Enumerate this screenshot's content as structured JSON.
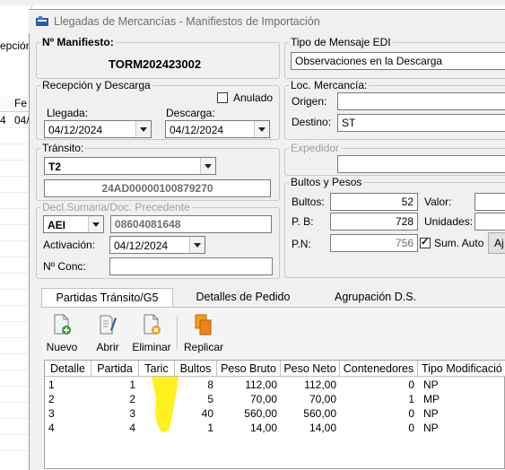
{
  "window": {
    "title": "Llegadas de Mercancías - Manifiestos de Importación"
  },
  "manifiesto": {
    "legend": "Nº Manifiesto:",
    "value": "TORM202423002"
  },
  "recepcion": {
    "legend": "Recepción y Descarga",
    "anulado_label": "Anulado",
    "anulado_checked": false,
    "llegada_label": "Llegada:",
    "llegada_value": "04/12/2024",
    "descarga_label": "Descarga:",
    "descarga_value": "04/12/2024"
  },
  "transito": {
    "legend": "Tránsito:",
    "tipo_value": "T2",
    "doc_value": "24AD00000100879270"
  },
  "declaracion": {
    "legend": "Decl.Sumaria/Doc. Precedente",
    "tipo_value": "AEI",
    "numero_value": "08604081648",
    "activacion_label": "Activación:",
    "activacion_value": "04/12/2024",
    "conc_label": "Nº Conc:",
    "conc_value": ""
  },
  "tipo_mensaje": {
    "legend": "Tipo de Mensaje EDI",
    "value": "Observaciones en la Descarga"
  },
  "loc_mercancia": {
    "legend": "Loc. Mercancía:",
    "origen_label": "Origen:",
    "origen_value": "",
    "destino_label": "Destino:",
    "destino_value": "ST"
  },
  "expedidor": {
    "legend": "Expedidor",
    "value": ""
  },
  "bultos_pesos": {
    "legend": "Bultos y Pesos",
    "bultos_label": "Bultos:",
    "bultos_value": "52",
    "pb_label": "P. B:",
    "pb_value": "728",
    "pn_label": "P.N:",
    "pn_value": "756",
    "valor_label": "Valor:",
    "unidades_label": "Unidades:",
    "sum_auto_label": "Sum. Auto",
    "sum_auto_checked": true,
    "aj_label": "Aj"
  },
  "tabs": [
    {
      "label": "Partidas Tránsito/G5",
      "active": true
    },
    {
      "label": "Detalles de Pedido",
      "active": false
    },
    {
      "label": "Agrupación D.S.",
      "active": false
    }
  ],
  "toolbar": {
    "nuevo": "Nuevo",
    "abrir": "Abrir",
    "eliminar": "Eliminar",
    "replicar": "Replicar"
  },
  "table": {
    "columns": [
      "Detalle",
      "Partida",
      "Taric",
      "Bultos",
      "Peso Bruto",
      "Peso Neto",
      "Contenedores",
      "Tipo Modificació"
    ],
    "rows": [
      {
        "detalle": "1",
        "partida": "1",
        "taric": "",
        "bultos": "8",
        "peso_bruto": "112,00",
        "peso_neto": "112,00",
        "contenedores": "0",
        "tipo": "NP"
      },
      {
        "detalle": "2",
        "partida": "2",
        "taric": "",
        "bultos": "5",
        "peso_bruto": "70,00",
        "peso_neto": "70,00",
        "contenedores": "1",
        "tipo": "MP"
      },
      {
        "detalle": "3",
        "partida": "3",
        "taric": "",
        "bultos": "40",
        "peso_bruto": "560,00",
        "peso_neto": "560,00",
        "contenedores": "0",
        "tipo": "NP"
      },
      {
        "detalle": "4",
        "partida": "4",
        "taric": "",
        "bultos": "1",
        "peso_bruto": "14,00",
        "peso_neto": "14,00",
        "contenedores": "0",
        "tipo": "NP"
      }
    ]
  },
  "background": {
    "left_caption": "epción",
    "col_header": "Fe",
    "row_cell_a": "4",
    "row_cell_b": "04/"
  },
  "colors": {
    "highlight": "#ffee00",
    "window_bg": "#f0f0f0",
    "title_text": "#6d6d6d"
  }
}
